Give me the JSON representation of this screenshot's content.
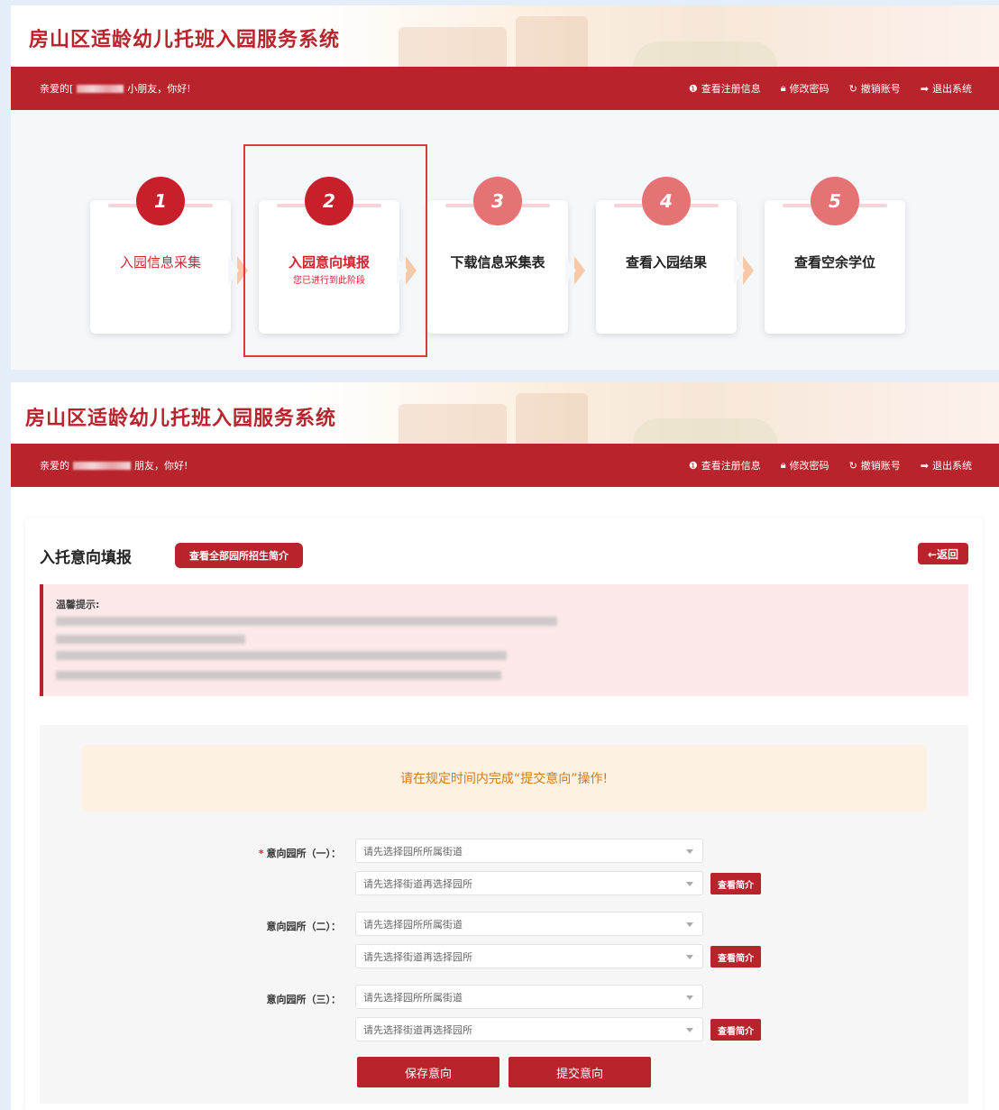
{
  "header": {
    "title": "房山区适龄幼儿托班入园服务系统",
    "greeting_prefix": "亲爱的",
    "greeting_suffix_top": "小朋友，你好!",
    "greeting_suffix_bottom": "朋友，你好!",
    "actions": [
      {
        "label": "查看注册信息",
        "icon": "info-icon"
      },
      {
        "label": "修改密码",
        "icon": "lock-icon"
      },
      {
        "label": "撤销账号",
        "icon": "undo-icon"
      },
      {
        "label": "退出系统",
        "icon": "logout-icon"
      }
    ]
  },
  "steps": [
    {
      "num": "1",
      "label": "入园信息采集"
    },
    {
      "num": "2",
      "label": "入园意向填报",
      "sub": "您已进行到此阶段"
    },
    {
      "num": "3",
      "label": "下载信息采集表"
    },
    {
      "num": "4",
      "label": "查看入园结果"
    },
    {
      "num": "5",
      "label": "查看空余学位"
    }
  ],
  "form": {
    "title": "入托意向填报",
    "view_all_button": "查看全部园所招生简介",
    "back_button": "返回",
    "tip_title": "温馨提示:",
    "notice": "请在规定时间内完成“提交意向”操作!",
    "rows": [
      {
        "label": "意向园所（一）：",
        "required": true
      },
      {
        "label": "意向园所（二）：",
        "required": false
      },
      {
        "label": "意向园所（三）：",
        "required": false
      }
    ],
    "street_placeholder": "请先选择园所所属街道",
    "kindergarten_placeholder": "请先选择街道再选择园所",
    "intro_button": "查看简介",
    "save_button": "保存意向",
    "submit_button": "提交意向"
  },
  "colors": {
    "brand_red": "#b9232c",
    "notice_orange": "#d27b1c",
    "highlight_border": "#e03b3b"
  }
}
